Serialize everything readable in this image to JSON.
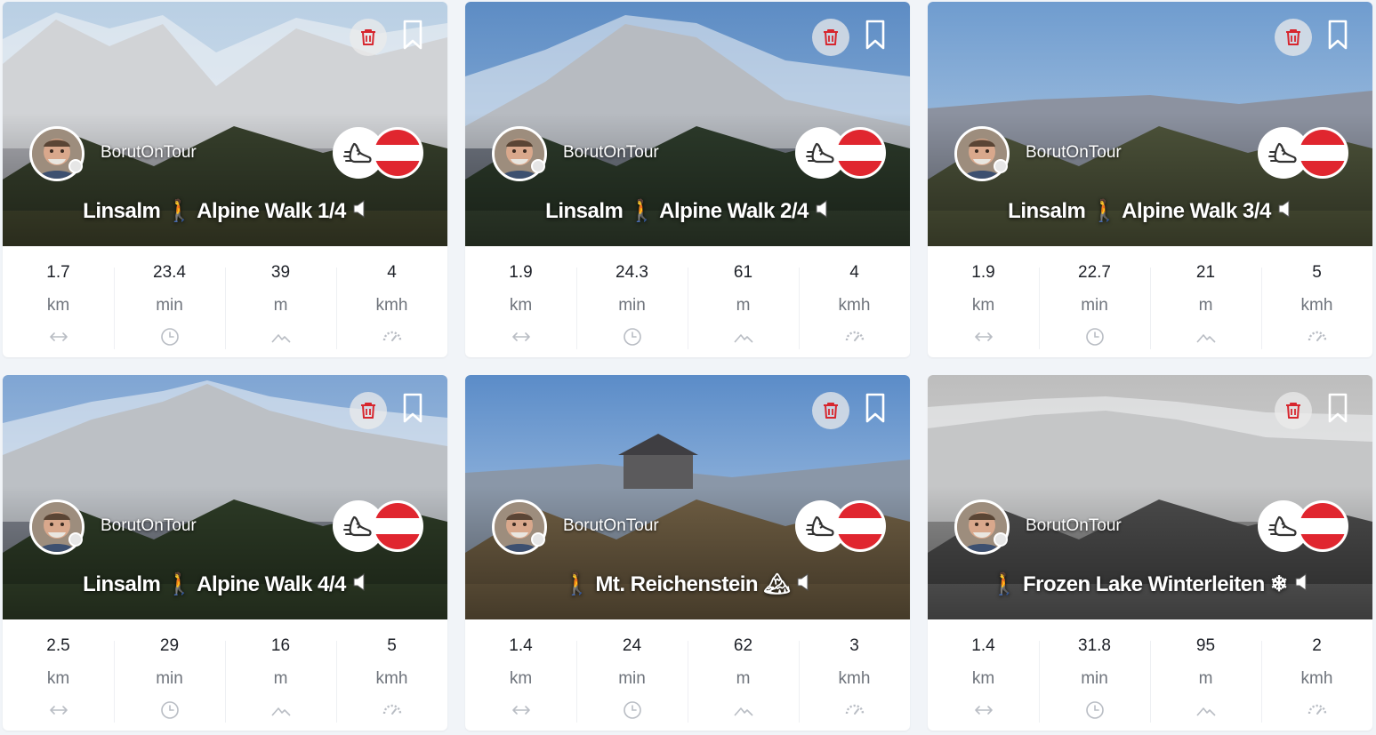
{
  "cards": [
    {
      "author": "BorutOnTour",
      "title": "Linsalm 🚶 Alpine Walk 1/4",
      "activity_icon": "walking-shoe-icon",
      "country_flag": "austria-flag-icon",
      "stats": [
        {
          "value": "1.7",
          "unit": "km",
          "icon": "distance-arrows-icon"
        },
        {
          "value": "23.4",
          "unit": "min",
          "icon": "clock-icon"
        },
        {
          "value": "39",
          "unit": "m",
          "icon": "elevation-icon"
        },
        {
          "value": "4",
          "unit": "kmh",
          "icon": "speedometer-icon"
        }
      ]
    },
    {
      "author": "BorutOnTour",
      "title": "Linsalm 🚶 Alpine Walk 2/4",
      "activity_icon": "walking-shoe-icon",
      "country_flag": "austria-flag-icon",
      "stats": [
        {
          "value": "1.9",
          "unit": "km",
          "icon": "distance-arrows-icon"
        },
        {
          "value": "24.3",
          "unit": "min",
          "icon": "clock-icon"
        },
        {
          "value": "61",
          "unit": "m",
          "icon": "elevation-icon"
        },
        {
          "value": "4",
          "unit": "kmh",
          "icon": "speedometer-icon"
        }
      ]
    },
    {
      "author": "BorutOnTour",
      "title": "Linsalm 🚶 Alpine Walk 3/4",
      "activity_icon": "walking-shoe-icon",
      "country_flag": "austria-flag-icon",
      "stats": [
        {
          "value": "1.9",
          "unit": "km",
          "icon": "distance-arrows-icon"
        },
        {
          "value": "22.7",
          "unit": "min",
          "icon": "clock-icon"
        },
        {
          "value": "21",
          "unit": "m",
          "icon": "elevation-icon"
        },
        {
          "value": "5",
          "unit": "kmh",
          "icon": "speedometer-icon"
        }
      ]
    },
    {
      "author": "BorutOnTour",
      "title": "Linsalm 🚶 Alpine Walk 4/4",
      "activity_icon": "walking-shoe-icon",
      "country_flag": "austria-flag-icon",
      "stats": [
        {
          "value": "2.5",
          "unit": "km",
          "icon": "distance-arrows-icon"
        },
        {
          "value": "29",
          "unit": "min",
          "icon": "clock-icon"
        },
        {
          "value": "16",
          "unit": "m",
          "icon": "elevation-icon"
        },
        {
          "value": "5",
          "unit": "kmh",
          "icon": "speedometer-icon"
        }
      ]
    },
    {
      "author": "BorutOnTour",
      "title": "🚶 Mt. Reichenstein 🏔",
      "activity_icon": "walking-shoe-icon",
      "country_flag": "austria-flag-icon",
      "stats": [
        {
          "value": "1.4",
          "unit": "km",
          "icon": "distance-arrows-icon"
        },
        {
          "value": "24",
          "unit": "min",
          "icon": "clock-icon"
        },
        {
          "value": "62",
          "unit": "m",
          "icon": "elevation-icon"
        },
        {
          "value": "3",
          "unit": "kmh",
          "icon": "speedometer-icon"
        }
      ]
    },
    {
      "author": "BorutOnTour",
      "title": "🚶 Frozen Lake Winterleiten ❄",
      "activity_icon": "walking-shoe-icon",
      "country_flag": "austria-flag-icon",
      "stats": [
        {
          "value": "1.4",
          "unit": "km",
          "icon": "distance-arrows-icon"
        },
        {
          "value": "31.8",
          "unit": "min",
          "icon": "clock-icon"
        },
        {
          "value": "95",
          "unit": "m",
          "icon": "elevation-icon"
        },
        {
          "value": "2",
          "unit": "kmh",
          "icon": "speedometer-icon"
        }
      ]
    }
  ],
  "colors": {
    "page_bg": "#f1f4f8",
    "card_bg": "#ffffff",
    "trash_red": "#d7262e",
    "flag_red": "#e0262f",
    "stat_value": "#1e2128",
    "stat_unit": "#6f747c",
    "stat_icon": "#b9bdc4"
  }
}
